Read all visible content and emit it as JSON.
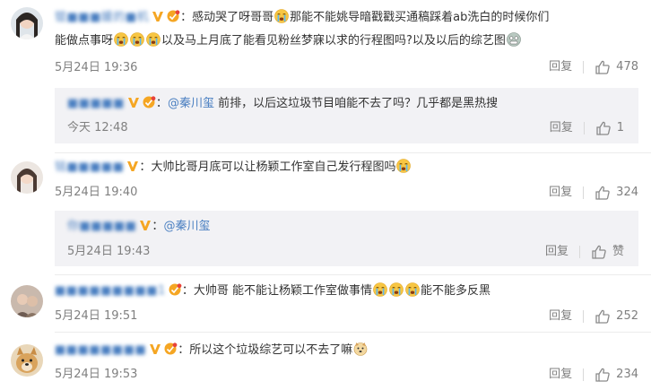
{
  "comments": [
    {
      "username": "锟■■■媛的■机",
      "text1": "感动哭了呀哥哥",
      "text2": "那能不能姚导暗戳戳买通稿踩着ab洗白的时候你们",
      "text3a": "能做点事呀",
      "text3b": "以及马上月底了能看见粉丝梦寐以求的行程图吗?以及以后的综艺图",
      "date": "5月24日 19:36",
      "reply_label": "回复",
      "likes": "478",
      "sub": {
        "username": "■■■■■",
        "mention": "@秦川玺",
        "text": "前排，以后这垃圾节目咱能不去了吗？几乎都是黑热搜",
        "date": "今天 12:48",
        "reply_label": "回复",
        "likes": "1"
      }
    },
    {
      "username": "铭■■■■■",
      "text": "大帅比哥月底可以让杨颖工作室自己发行程图吗",
      "date": "5月24日 19:40",
      "reply_label": "回复",
      "likes": "324",
      "sub": {
        "username": "你■■■■■",
        "mention": "@秦川玺",
        "date": "5月24日 19:43",
        "reply_label": "回复",
        "likes": "赞"
      }
    },
    {
      "username": "■■■■■■■■■1",
      "text1": "大帅哥 能不能让杨颖工作室做事情",
      "text2": "能不能多反黑",
      "date": "5月24日 19:51",
      "reply_label": "回复",
      "likes": "252"
    },
    {
      "username": "■■■■■■■■",
      "text": "所以这个垃圾综艺可以不去了嘛",
      "date": "5月24日 19:53",
      "reply_label": "回复",
      "likes": "234"
    }
  ],
  "colors": {
    "link": "#4a7fc1",
    "meta": "#808080",
    "subbox": "#f2f2f5",
    "badge": "#f5a623"
  }
}
